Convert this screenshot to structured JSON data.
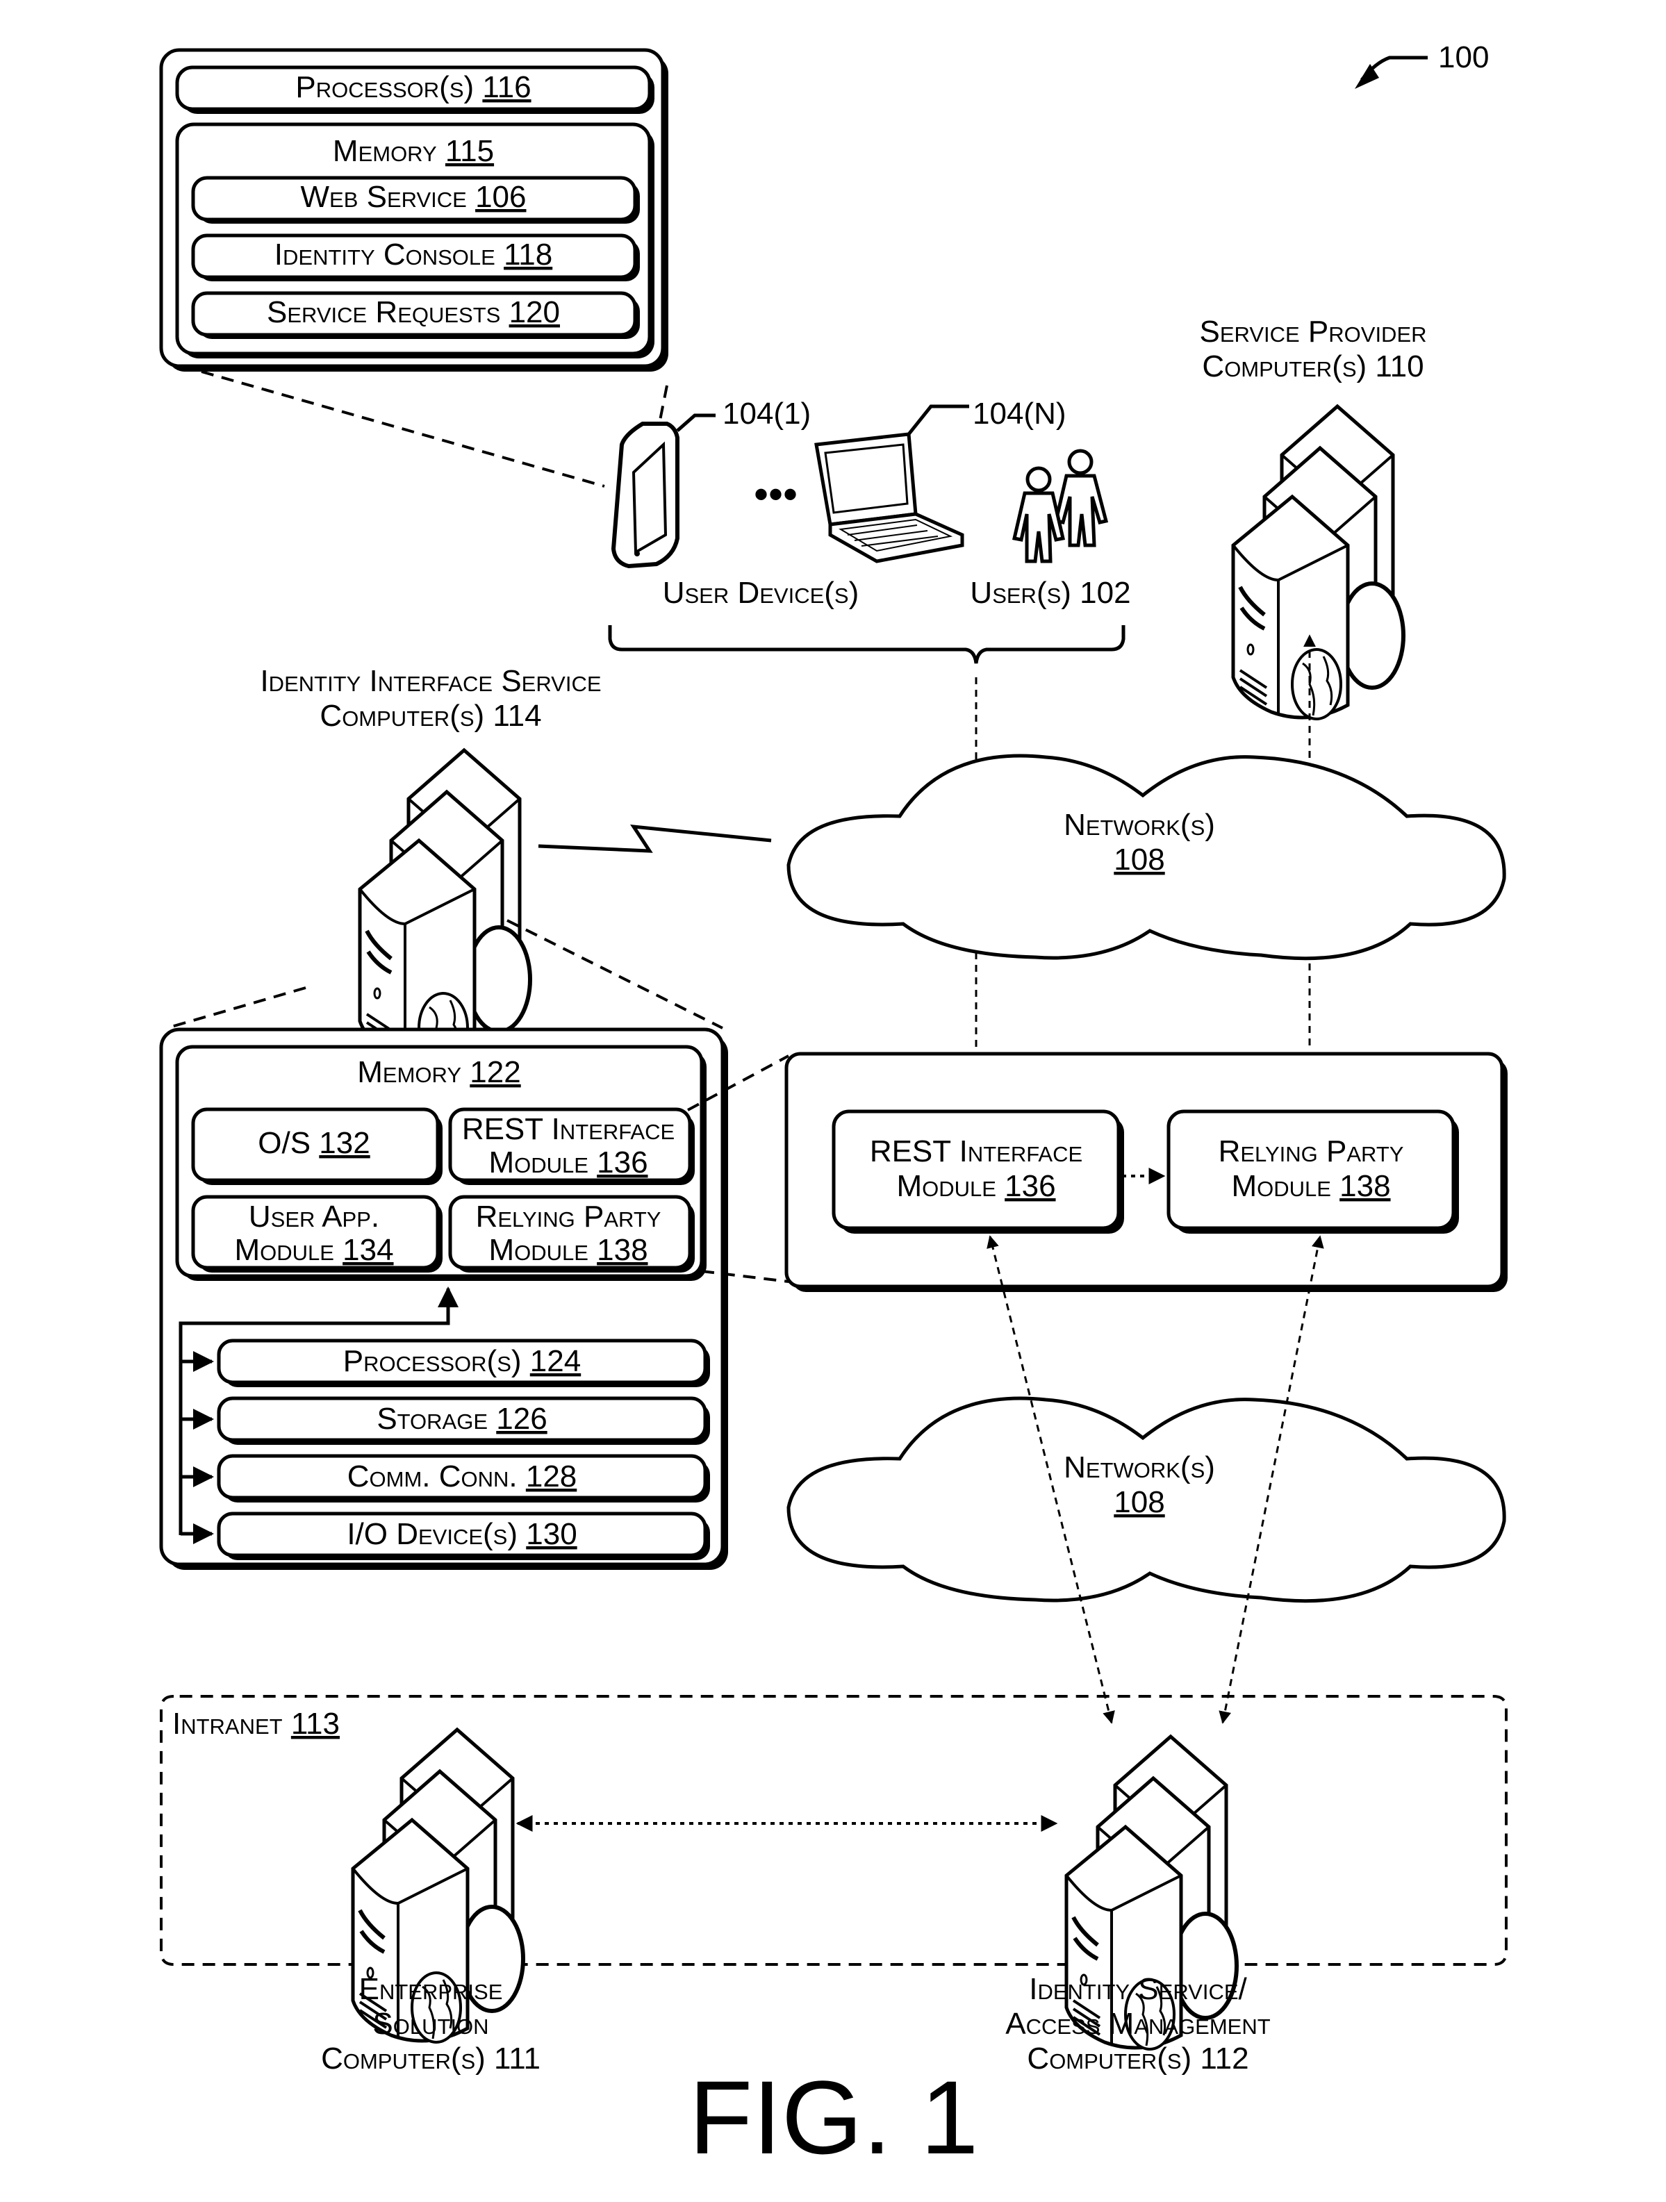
{
  "figure": {
    "label": "FIG. 1",
    "ref": "100"
  },
  "user_computer": {
    "processor": {
      "text": "Processor(s) ",
      "ref": "116"
    },
    "memory": {
      "text": "Memory ",
      "ref": "115"
    },
    "memory_items": [
      {
        "text": "Web Service ",
        "ref": "106"
      },
      {
        "text": "Identity Console ",
        "ref": "118"
      },
      {
        "text": "Service Requests ",
        "ref": "120"
      }
    ]
  },
  "user_devices": {
    "device_1_ref": "104(1)",
    "device_n_ref": "104(N)",
    "ellipsis": "•••",
    "devices_label": "User Device(s)",
    "users_label": "User(s) 102"
  },
  "service_provider": {
    "label_line1": "Service Provider",
    "label_line2": "Computer(s) 110"
  },
  "identity_interface": {
    "label_line1": "Identity Interface Service",
    "label_line2": "Computer(s) 114"
  },
  "networks": [
    {
      "text": "Network(s)",
      "ref": "108"
    },
    {
      "text": "Network(s)",
      "ref": "108"
    }
  ],
  "interface_computer": {
    "memory": {
      "text": "Memory ",
      "ref": "122"
    },
    "modules": [
      {
        "line1": "O/S ",
        "ref": "132",
        "line2": ""
      },
      {
        "line1": "REST Interface",
        "line2": "Module ",
        "ref": "136"
      },
      {
        "line1": "User App.",
        "line2": "Module ",
        "ref": "134"
      },
      {
        "line1": "Relying Party",
        "line2": "Module ",
        "ref": "138"
      }
    ],
    "components": [
      {
        "text": "Processor(s) ",
        "ref": "124"
      },
      {
        "text": "Storage ",
        "ref": "126"
      },
      {
        "text": "Comm. Conn. ",
        "ref": "128"
      },
      {
        "text": "I/O Device(s) ",
        "ref": "130"
      }
    ]
  },
  "module_panel": {
    "rest": {
      "line1": "REST Interface",
      "line2": "Module ",
      "ref": "136"
    },
    "relying": {
      "line1": "Relying Party",
      "line2": "Module ",
      "ref": "138"
    }
  },
  "intranet": {
    "text": "Intranet ",
    "ref": "113"
  },
  "enterprise": {
    "line1": "Enterprise",
    "line2": "Solution",
    "line3": "Computer(s) 111"
  },
  "identity_service": {
    "line1": "Identity Service/",
    "line2": "Access Management",
    "line3": "Computer(s) 112"
  }
}
